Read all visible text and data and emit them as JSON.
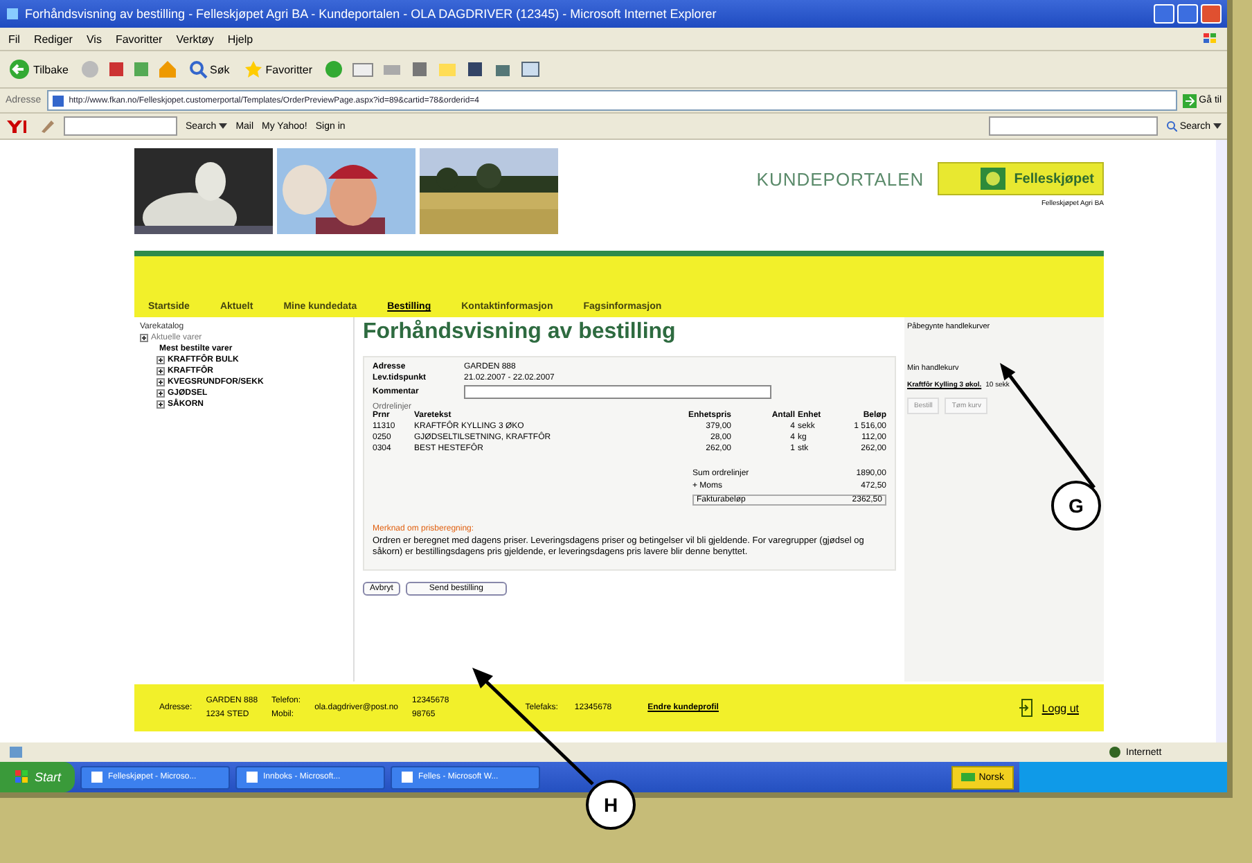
{
  "window": {
    "title": "Forhåndsvisning av bestilling - Felleskjøpet Agri BA - Kundeportalen - OLA DAGDRIVER (12345) - Microsoft Internet Explorer"
  },
  "menu_bar": [
    "Fil",
    "Rediger",
    "Vis",
    "Favoritter",
    "Verktøy",
    "Hjelp"
  ],
  "toolbar": {
    "back": "Tilbake",
    "search": "Søk",
    "favorites": "Favoritter"
  },
  "address_bar": {
    "label": "Adresse",
    "url": "http://www.fkan.no/Felleskjopet.customerportal/Templates/OrderPreviewPage.aspx?id=89&cartid=78&orderid=4",
    "go": "Gå til"
  },
  "search_toolbar": {
    "search": "Search",
    "mail": "Mail",
    "my": "My Yahoo!",
    "sign_in": "Sign in",
    "search2": "Search"
  },
  "site": {
    "portal": "KUNDEPORTALEN",
    "logo": "Felleskjøpet",
    "company": "Felleskjøpet Agri BA"
  },
  "nav": [
    {
      "label": "Startside",
      "selected": false
    },
    {
      "label": "Aktuelt",
      "selected": false
    },
    {
      "label": "Mine kundedata",
      "selected": false
    },
    {
      "label": "Bestilling",
      "selected": true
    },
    {
      "label": "Kontaktinformasjon",
      "selected": false
    },
    {
      "label": "Fagsinformasjon",
      "selected": false
    }
  ],
  "sidebar": {
    "title": "Varekatalog",
    "section": "Aktuelle varer",
    "heading": "Mest bestilte varer",
    "items": [
      "KRAFTFÔR BULK",
      "KRAFTFÔR",
      "KVEGSRUNDFOR/SEKK",
      "GJØDSEL",
      "SÅKORN"
    ]
  },
  "order": {
    "title": "Forhåndsvisning av bestilling",
    "fields": [
      {
        "label": "Adresse",
        "value": "GARDEN 888"
      },
      {
        "label": "Lev.tidspunkt",
        "value": "21.02.2007 - 22.02.2007"
      }
    ],
    "comment_label": "Kommentar",
    "lines_title": "Ordrelinjer",
    "columns": [
      "Prnr",
      "Varetekst",
      "Enhetspris",
      "Antall",
      "Enhet",
      "Beløp"
    ],
    "rows": [
      [
        "11310",
        "KRAFTFÔR KYLLING 3 ØKO",
        "379,00",
        "4",
        "sekk",
        "1 516,00"
      ],
      [
        "0250",
        "GJØDSELTILSETNING, KRAFTFÔR",
        "28,00",
        "4",
        "kg",
        "112,00"
      ],
      [
        "0304",
        "BEST HESTEFÔR",
        "262,00",
        "1",
        "stk",
        "262,00"
      ]
    ],
    "totals": [
      {
        "label": "Sum ordrelinjer",
        "value": "1890,00"
      },
      {
        "label": "+ Moms",
        "value": "472,50"
      },
      {
        "label": "Fakturabeløp",
        "value": "2362,50"
      }
    ],
    "note_title": "Merknad om prisberegning:",
    "note": "Ordren er beregnet med dagens priser. Leveringsdagens priser og betingelser vil bli gjeldende. For varegrupper (gjødsel og såkorn) er bestillingsdagens pris gjeldende, er leveringsdagens pris lavere blir denne benyttet.",
    "buttons": [
      "Avbryt",
      "Send bestilling"
    ]
  },
  "cart": {
    "title": "Påbegynte handlekurver",
    "heading": "Min handlekurv",
    "item": "Kraftfôr Kylling 3 økol.",
    "qty": "10 sekk",
    "buttons": [
      "Bestill",
      "Tøm kurv"
    ]
  },
  "footer": {
    "address_label": "Adresse:",
    "address": [
      "GARDEN 888",
      "1234 STED"
    ],
    "phone_label": "Telefon:",
    "phone": "12345678",
    "mobile_label": "Mobil:",
    "mobile": "98765",
    "email": "ola.dagdriver@post.no",
    "fax_label": "Telefaks:",
    "fax": "12345678",
    "profile": "Endre kundeprofil",
    "logout": "Logg ut"
  },
  "status_bar": {
    "zone": "Internett"
  },
  "taskbar": {
    "start": "Start",
    "tasks": [
      "Felleskjøpet - Microso...",
      "Innboks - Microsoft...",
      "Felles - Microsoft W..."
    ],
    "language": "Norsk"
  },
  "callouts": [
    "G",
    "H"
  ]
}
